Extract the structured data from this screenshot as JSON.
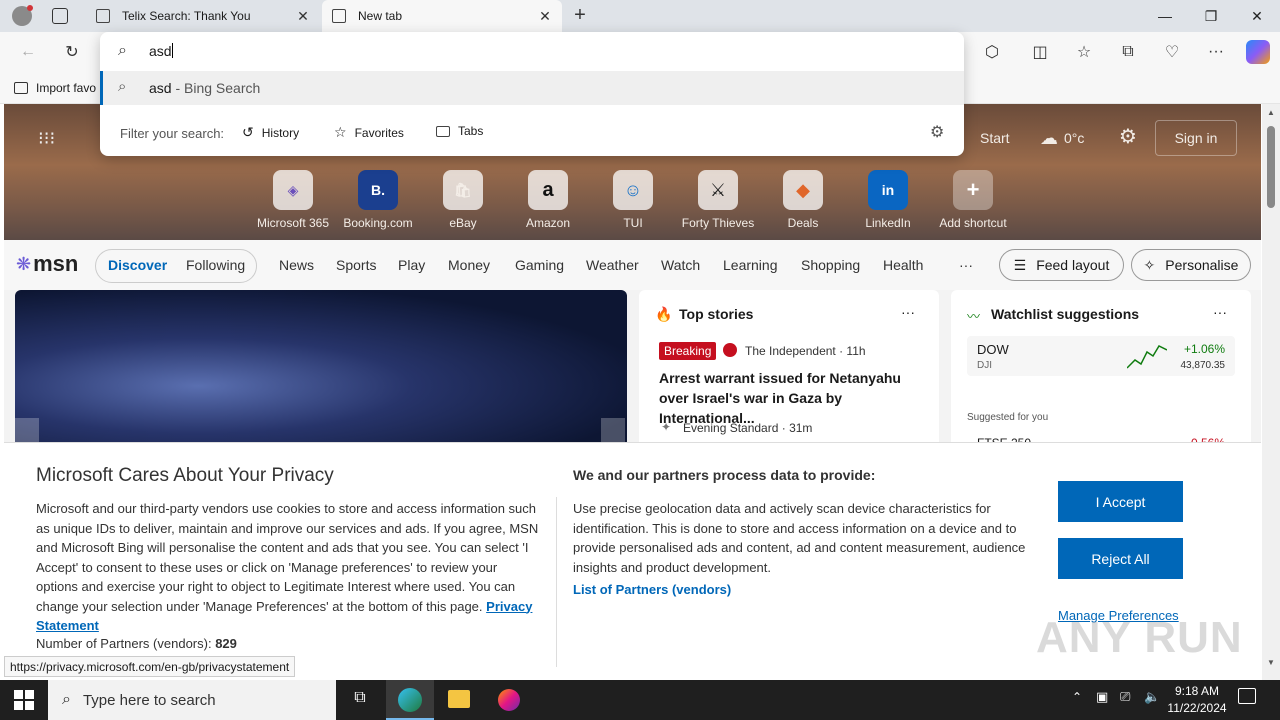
{
  "tabs": [
    {
      "title": "Telix Search: Thank You"
    },
    {
      "title": "New tab"
    }
  ],
  "address_bar": {
    "value": "asd"
  },
  "suggestions": [
    {
      "query": "asd",
      "suffix": " - Bing Search"
    }
  ],
  "filter": {
    "label": "Filter your search:",
    "options": [
      "History",
      "Favorites",
      "Tabs"
    ]
  },
  "favorites_bar": {
    "import_label": "Import favo"
  },
  "weather": {
    "temp": "0°c",
    "start_label": "Start"
  },
  "sign_in_label": "Sign in",
  "shortcuts": [
    {
      "label": "Microsoft 365",
      "glyph": "◈"
    },
    {
      "label": "Booking.com",
      "glyph": "B."
    },
    {
      "label": "eBay",
      "glyph": "🛍"
    },
    {
      "label": "Amazon",
      "glyph": "a"
    },
    {
      "label": "TUI",
      "glyph": "☺"
    },
    {
      "label": "Forty Thieves",
      "glyph": "⚔"
    },
    {
      "label": "Deals",
      "glyph": "◆"
    },
    {
      "label": "LinkedIn",
      "glyph": "in"
    },
    {
      "label": "Add shortcut",
      "glyph": "+"
    }
  ],
  "msn": {
    "logo": "msn",
    "tabs": [
      "Discover",
      "Following"
    ],
    "nav": [
      "News",
      "Sports",
      "Play",
      "Money",
      "Gaming",
      "Weather",
      "Watch",
      "Learning",
      "Shopping",
      "Health"
    ],
    "more": "···",
    "feed_layout": "Feed layout",
    "personalise": "Personalise"
  },
  "top_stories": {
    "title": "Top stories",
    "badge": "Breaking",
    "source": "The Independent · 11h",
    "headline": "Arrest warrant issued for Netanyahu over Israel's war in Gaza by International...",
    "source2": "Evening Standard · 31m"
  },
  "watchlist": {
    "title": "Watchlist suggestions",
    "ticker": "DOW",
    "ticker_sub": "DJI",
    "change": "+1.06%",
    "price": "43,870.35",
    "suggested": "Suggested for you",
    "ticker2": "FTSE 250",
    "change2": "-0.56%"
  },
  "privacy": {
    "title": "Microsoft Cares About Your Privacy",
    "body": "Microsoft and our third-party vendors use cookies to store and access information such as unique IDs to deliver, maintain and improve our services and ads. If you agree, MSN and Microsoft Bing will personalise the content and ads that you see. You can select 'I Accept' to consent to these uses or click on 'Manage preferences' to review your options and exercise your right to object to Legitimate Interest where used. You can change your selection under 'Manage Preferences' at the bottom of this page.",
    "privacy_link": "Privacy Statement",
    "partners_label": "Number of Partners (vendors):",
    "partners_count": "829",
    "process_title": "We and our partners process data to provide:",
    "process_body": "Use precise geolocation data and actively scan device characteristics for identification. This is done to store and access information on a device and to provide personalised ads and content, ad and content measurement, audience insights and product development.",
    "vendors_link": "List of Partners (vendors)",
    "accept": "I Accept",
    "reject": "Reject All",
    "manage": "Manage Preferences"
  },
  "status_url": "https://privacy.microsoft.com/en-gb/privacystatement",
  "watermark": "ANY RUN",
  "taskbar": {
    "search_placeholder": "Type here to search",
    "time": "9:18 AM",
    "date": "11/22/2024"
  },
  "colors": {
    "accent": "#0067b8",
    "breaking": "#c50f1f",
    "positive": "#107c10"
  }
}
